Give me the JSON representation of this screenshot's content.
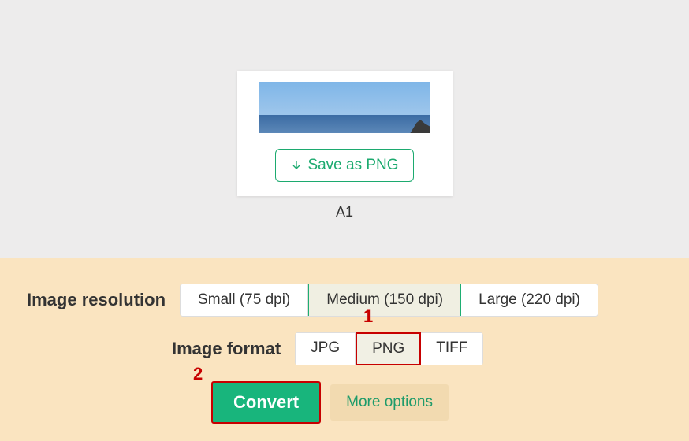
{
  "preview": {
    "save_label": "Save as PNG",
    "caption": "A1"
  },
  "resolution": {
    "label": "Image resolution",
    "options": [
      "Small (75 dpi)",
      "Medium (150 dpi)",
      "Large (220 dpi)"
    ],
    "selected": "Medium (150 dpi)"
  },
  "format": {
    "label": "Image format",
    "options": [
      "JPG",
      "PNG",
      "TIFF"
    ],
    "selected": "PNG"
  },
  "actions": {
    "convert_label": "Convert",
    "more_options_label": "More options"
  },
  "annotations": {
    "one": "1",
    "two": "2"
  }
}
